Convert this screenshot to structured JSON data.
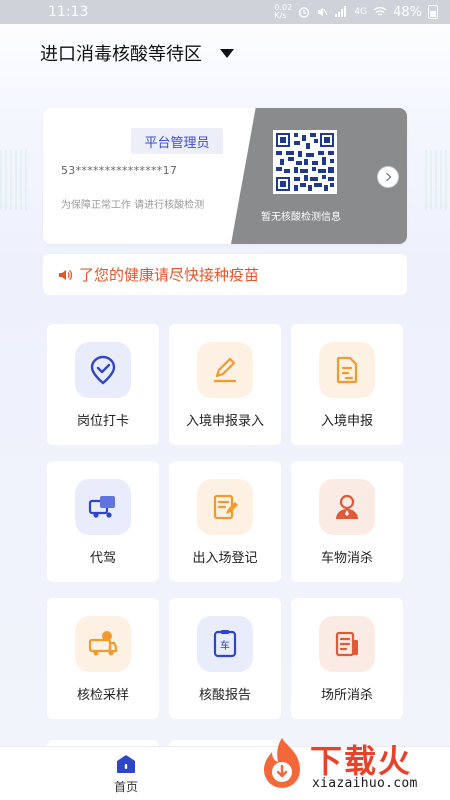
{
  "status_bar": {
    "time": "11:13",
    "network_speed": "0.02 K/s",
    "network_type": "4G",
    "battery": "48%"
  },
  "header": {
    "location": "进口消毒核酸等待区",
    "dropdown_icon": "triangle-down-icon"
  },
  "user_card": {
    "role": "平台管理员",
    "id_masked": "53***************17",
    "hint": "为保障正常工作 请进行核酸检测",
    "qr_status": "暂无核酸检测信息",
    "colors": {
      "panel": "#8a8b8c",
      "role_text": "#3c4cd6"
    }
  },
  "notice": {
    "icon": "speaker-icon",
    "text": "了您的健康请尽快接种疫苗",
    "color": "#e8552a"
  },
  "menu": [
    {
      "label": "岗位打卡",
      "icon": "location-check-icon",
      "tone": "blue"
    },
    {
      "label": "入境申报录入",
      "icon": "pencil-edit-icon",
      "tone": "orange"
    },
    {
      "label": "入境申报",
      "icon": "document-icon",
      "tone": "orange"
    },
    {
      "label": "代驾",
      "icon": "truck-icon",
      "tone": "blue"
    },
    {
      "label": "出入场登记",
      "icon": "register-form-icon",
      "tone": "orange"
    },
    {
      "label": "车物消杀",
      "icon": "worker-icon",
      "tone": "red"
    },
    {
      "label": "核检采样",
      "icon": "sample-truck-icon",
      "tone": "orange"
    },
    {
      "label": "核酸报告",
      "icon": "vehicle-report-icon",
      "tone": "blue"
    },
    {
      "label": "场所消杀",
      "icon": "site-document-icon",
      "tone": "red"
    }
  ],
  "bottom_nav": {
    "home_label": "首页",
    "home_icon": "home-icon"
  },
  "watermark": {
    "title": "下载火",
    "url": "xiazaihuo.com"
  }
}
